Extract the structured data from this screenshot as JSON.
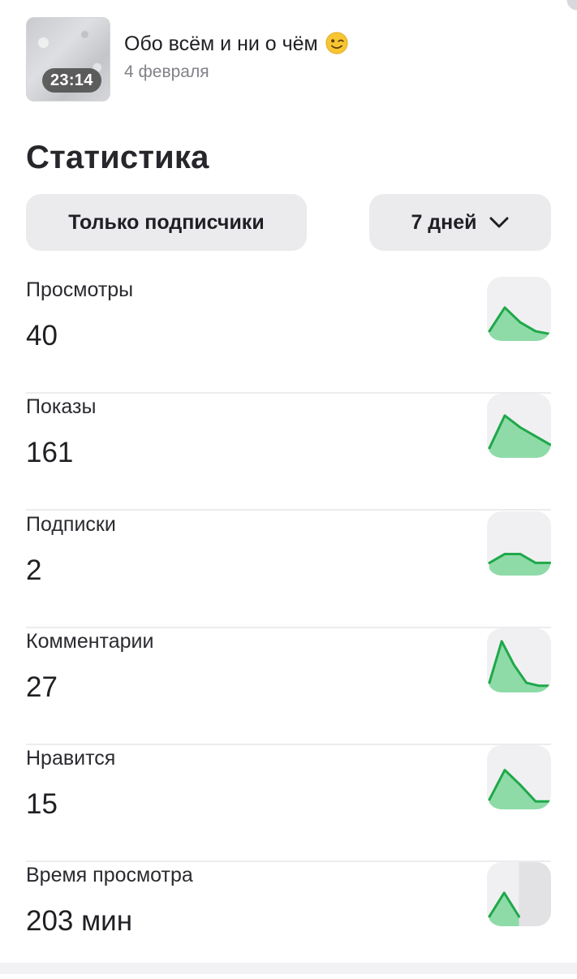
{
  "post": {
    "title": "Обо всём и ни о чём",
    "title_emoji": "winking-face",
    "date": "4 февраля",
    "duration": "23:14"
  },
  "stats_section": {
    "title": "Статистика",
    "audience_filter_label": "Только подписчики",
    "period_filter_label": "7 дней"
  },
  "colors": {
    "accent_green": "#1fa84a",
    "fill_green": "#8edba8",
    "tile_bg": "#f0f0f2",
    "button_bg": "#ebebee"
  },
  "stats": [
    {
      "label": "Просмотры",
      "value": "40",
      "trend": [
        0.15,
        0.55,
        0.3,
        0.15,
        0.1
      ]
    },
    {
      "label": "Показы",
      "value": "161",
      "trend": [
        0.15,
        0.7,
        0.5,
        0.35,
        0.2
      ]
    },
    {
      "label": "Подписки",
      "value": "2",
      "trend": [
        0.2,
        0.35,
        0.35,
        0.2,
        0.2
      ]
    },
    {
      "label": "Комментарии",
      "value": "27",
      "trend": [
        0.15,
        0.85,
        0.45,
        0.15,
        0.1,
        0.1
      ]
    },
    {
      "label": "Нравится",
      "value": "15",
      "trend": [
        0.15,
        0.65,
        0.4,
        0.12,
        0.12
      ]
    },
    {
      "label": "Время просмотра",
      "value": "203 мин",
      "trend": [
        0.15,
        0.55,
        0.15
      ],
      "partial_fraction": 0.5
    }
  ]
}
